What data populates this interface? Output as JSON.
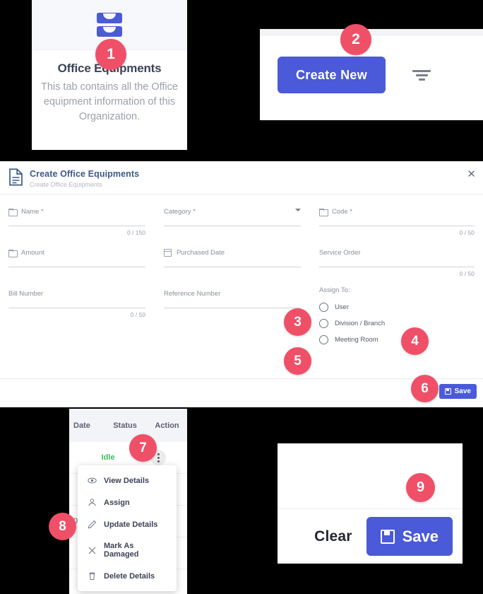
{
  "tile": {
    "icon": "inbox-icon",
    "title": "Office Equipments",
    "description": "This tab contains all the Office equipment information of this Organization."
  },
  "toolbar": {
    "create_new_label": "Create New",
    "filter_icon": "filter-icon"
  },
  "form": {
    "icon": "document-icon",
    "title": "Create Office Equipments",
    "subtitle": "Create Office Equipments",
    "close_label": "✕",
    "fields": [
      {
        "label": "Name *",
        "icon": "folder-icon",
        "counter": "0 / 150",
        "type": "text"
      },
      {
        "label": "Category *",
        "icon": "none",
        "counter": "",
        "type": "select"
      },
      {
        "label": "Code *",
        "icon": "folder-icon",
        "counter": "0 / 50",
        "type": "text"
      },
      {
        "label": "Amount",
        "icon": "folder-icon",
        "counter": "",
        "type": "text"
      },
      {
        "label": "Purchased Date",
        "icon": "calendar-icon",
        "counter": "",
        "type": "date"
      },
      {
        "label": "Service Order",
        "icon": "none",
        "counter": "0 / 50",
        "type": "text"
      },
      {
        "label": "Bill Number",
        "icon": "none",
        "counter": "0 / 50",
        "type": "text"
      },
      {
        "label": "Reference Number",
        "icon": "none",
        "counter": "",
        "type": "text"
      }
    ],
    "assign": {
      "title": "Assign To:",
      "options": [
        {
          "label": "User"
        },
        {
          "label": "Division / Branch"
        },
        {
          "label": "Meeting Room"
        }
      ]
    },
    "save_label": "Save",
    "save_icon": "floppy-disk-icon"
  },
  "table": {
    "columns": [
      "Date",
      "Status",
      "Action"
    ],
    "rows": [
      {
        "status": "Idle",
        "action_icon": "kebab-menu-icon"
      },
      {
        "amount": ""
      },
      {
        "amount": "0"
      },
      {
        "amount": ""
      }
    ]
  },
  "context_menu": {
    "items": [
      {
        "label": "View Details",
        "icon": "eye-icon"
      },
      {
        "label": "Assign",
        "icon": "person-icon"
      },
      {
        "label": "Update Details",
        "icon": "pencil-icon"
      },
      {
        "label": "Mark As Damaged",
        "icon": "x-icon"
      },
      {
        "label": "Delete Details",
        "icon": "trash-icon"
      }
    ]
  },
  "clear_save": {
    "clear_label": "Clear",
    "save_label": "Save",
    "save_icon": "floppy-disk-icon"
  },
  "badges": {
    "b1": "1",
    "b2": "2",
    "b3": "3",
    "b4": "4",
    "b5": "5",
    "b6": "6",
    "b7": "7",
    "b8": "8",
    "b9": "9"
  },
  "colors": {
    "accent_blue": "#4a5ad8",
    "badge_red": "#ef5068",
    "status_green": "#3dbb5e",
    "title_blue": "#3d5a8a"
  }
}
